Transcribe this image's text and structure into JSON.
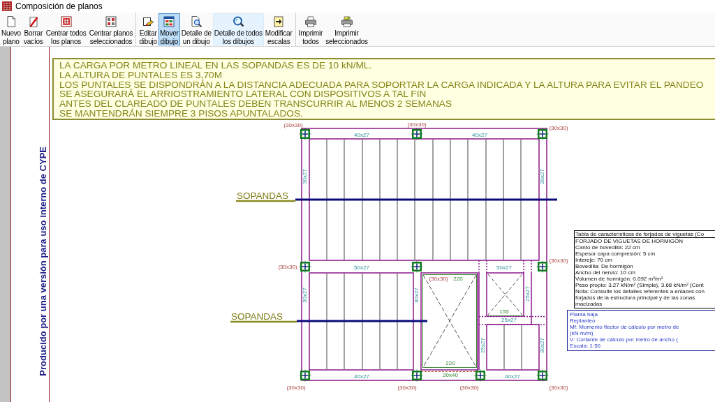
{
  "window": {
    "title": "Composición de planos"
  },
  "toolbar": [
    {
      "buttons": [
        {
          "kind": "new-plan",
          "label": [
            "Nuevo",
            "plano"
          ],
          "selected": false,
          "hovered": false
        },
        {
          "kind": "clear-empty",
          "label": [
            "Borrar",
            "vacíos"
          ],
          "selected": false,
          "hovered": false
        },
        {
          "kind": "center-all",
          "label": [
            "Centrar todos",
            "los planos"
          ],
          "selected": false,
          "hovered": false
        },
        {
          "kind": "center-selected",
          "label": [
            "Centrar planos",
            "seleccionados"
          ],
          "selected": false,
          "hovered": false
        }
      ]
    },
    {
      "buttons": [
        {
          "kind": "edit-drawing",
          "label": [
            "Editar",
            "dibujo"
          ],
          "selected": false,
          "hovered": false
        },
        {
          "kind": "move-drawing",
          "label": [
            "Mover",
            "dibujo"
          ],
          "selected": true,
          "hovered": false
        },
        {
          "kind": "detail-one",
          "label": [
            "Detalle de",
            "un dibujo"
          ],
          "selected": false,
          "hovered": false
        },
        {
          "kind": "detail-all",
          "label": [
            "Detalle de todos",
            "los dibujos"
          ],
          "selected": false,
          "hovered": true
        },
        {
          "kind": "edit-scales",
          "label": [
            "Modificar",
            "escalas"
          ],
          "selected": false,
          "hovered": false
        }
      ]
    },
    {
      "buttons": [
        {
          "kind": "print-all",
          "label": [
            "Imprimir",
            "todos"
          ],
          "selected": false,
          "hovered": false
        },
        {
          "kind": "print-selected",
          "label": [
            "Imprimir",
            "seleccionados"
          ],
          "selected": false,
          "hovered": false
        }
      ]
    }
  ],
  "sheet": {
    "side_note": "Producido por una versión para uso interno de CYPE",
    "notes": [
      "LA CARGA POR METRO LINEAL EN LAS SOPANDAS ES DE 10 kN/ML.",
      "LA ALTURA DE PUNTALES ES 3,70M",
      "LOS PUNTALES SE DISPONDRÁN A LA DISTANCIA ADECUADA PARA SOPORTAR LA CARGA INDICADA Y LA ALTURA PARA EVITAR EL PANDEO",
      "SE ASEGURARÁ EL ARRIOSTRAMIENTO LATERAL CON DISPOSITIVOS A TAL FIN",
      "ANTES DEL CLAREADO DE PUNTALES DEBEN TRANSCURRIR AL MENOS 2 SEMANAS",
      "SE MANTENDRÁN SIEMPRE 3 PISOS APUNTALADOS."
    ],
    "plan": {
      "callouts": [
        "SOPANDAS",
        "SOPANDAS"
      ],
      "beam_labels": [
        "40x27",
        "40x27",
        "50x27",
        "50x27",
        "40x27",
        "40x27",
        "25x27",
        "30x27",
        "30x27",
        "30x27",
        "30x27",
        "25x27",
        "30x27",
        "25x27"
      ],
      "column_labels": [
        "(30x30)",
        "(30x30)",
        "(30x30)",
        "(30x30)",
        "(30x30)",
        "(30x30)",
        "(30x30)",
        "(30x30)",
        "(30x30)",
        "(30x30)"
      ],
      "dimension_labels": [
        "220",
        "220",
        "20x40",
        "155"
      ]
    },
    "slab_table": {
      "title": "Tabla de características de forjados de viguetas (Co",
      "lines": [
        "FORJADO DE VIGUETAS DE HORMIGÓN",
        "Canto de bovedilla: 22 cm",
        "Espesor capa compresión: 5 cm",
        "Intereje: 70 cm",
        "Bovedilla: De hormigón",
        "Ancho del nervio: 10 cm",
        "Volumen de hormigón: 0.092 m³/m²",
        "Peso propio: 3.27 kN/m² (Simple), 3.68 kN/m² (Cont",
        "Nota: Consulte los detalles referentes a enlaces con",
        "forjados de la estructura principal y de las zonas",
        "macizadas"
      ]
    },
    "legend": {
      "lines": [
        "Planta baja",
        "Replanteo",
        "Mf: Momento flector de cálculo por metro de",
        "(kN·m/m)",
        "V: Cortante de cálculo por metro de ancho (",
        "Escala: 1:50"
      ]
    }
  }
}
